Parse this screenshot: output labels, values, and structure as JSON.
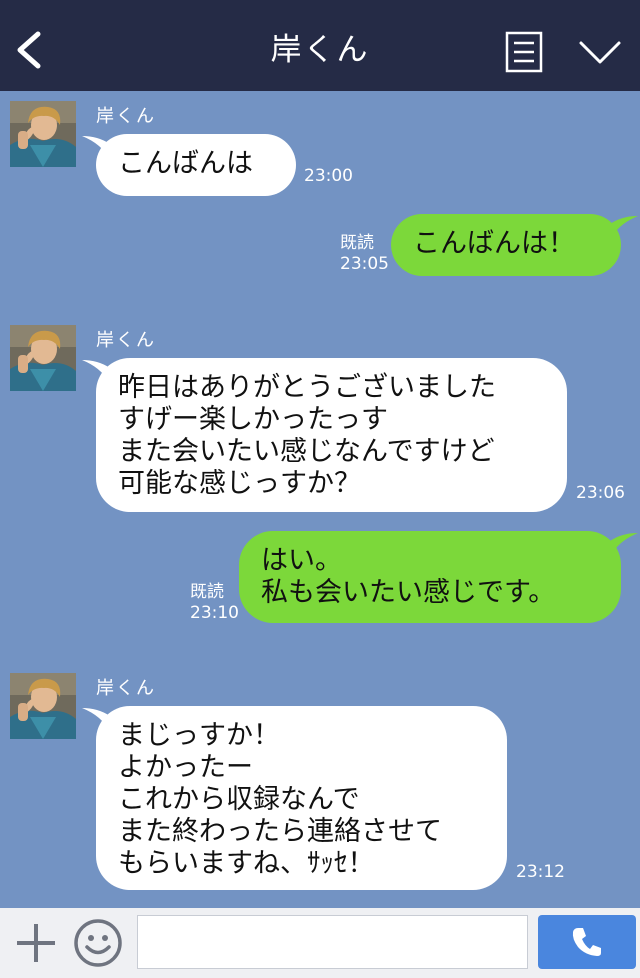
{
  "header": {
    "title": "岸くん",
    "back_icon": "chevron-left-icon",
    "menu_icon": "note-icon",
    "down_icon": "chevron-down-icon",
    "bg_color": "#252b46"
  },
  "chat": {
    "bg_color": "#7393c3",
    "incoming_bubble_color": "#ffffff",
    "outgoing_bubble_color": "#7cd83a",
    "messages": [
      {
        "direction": "in",
        "sender": "岸くん",
        "text": "こんばんは",
        "time": "23:00"
      },
      {
        "direction": "out",
        "read_label": "既読",
        "text": "こんばんは！",
        "time": "23:05"
      },
      {
        "direction": "in",
        "sender": "岸くん",
        "text": "昨日はありがとうございました\nすげー楽しかったっす\nまた会いたい感じなんですけど\n可能な感じっすか？",
        "time": "23:06"
      },
      {
        "direction": "out",
        "read_label": "既読",
        "text": "はい。\n私も会いたい感じです。",
        "time": "23:10"
      },
      {
        "direction": "in",
        "sender": "岸くん",
        "text": "まじっすか！\nよかったー\nこれから収録なんで\nまた終わったら連絡させて\nもらいますね、ｻｯｾ！",
        "time": "23:12"
      }
    ]
  },
  "input_bar": {
    "plus_icon": "plus-icon",
    "sticker_icon": "smiley-icon",
    "placeholder": "",
    "call_icon": "phone-icon",
    "call_button_color": "#4a86de"
  }
}
